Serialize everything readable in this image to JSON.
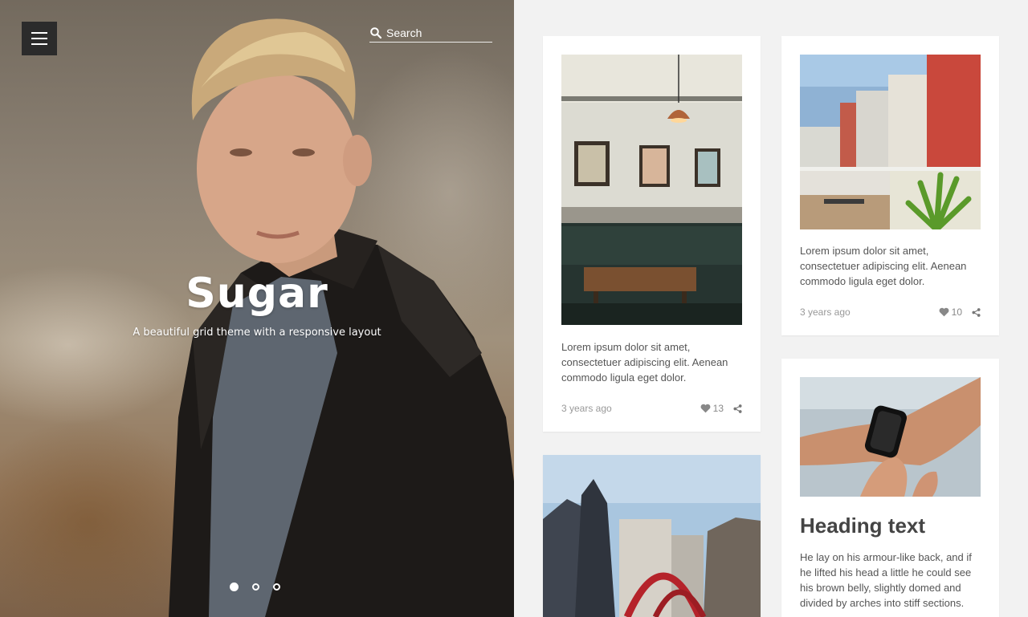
{
  "hero": {
    "title": "Sugar",
    "subtitle": "A beautiful grid theme with a responsive layout",
    "slides": 3,
    "active_slide": 1
  },
  "search": {
    "placeholder": "Search"
  },
  "menu": {
    "icon": "hamburger-icon"
  },
  "cards": [
    {
      "excerpt": "Lorem ipsum dolor sit amet, consectetuer adipiscing elit. Aenean commodo ligula eget dolor.",
      "time": "3 years ago",
      "likes": "13"
    },
    {
      "excerpt": "Lorem ipsum dolor sit amet, consectetuer adipiscing elit. Aenean commodo ligula eget dolor.",
      "time": "3 years ago",
      "likes": "10"
    },
    {
      "heading": "Heading text",
      "body": "He lay on his armour-like back, and if he lifted his head a little he could see his brown belly, slightly domed and divided by arches into stiff sections."
    }
  ],
  "colors": {
    "page_bg": "#f2f2f2",
    "card_bg": "#ffffff",
    "menu_bg": "#2b2b2b",
    "text": "#555555",
    "meta": "#999999"
  }
}
